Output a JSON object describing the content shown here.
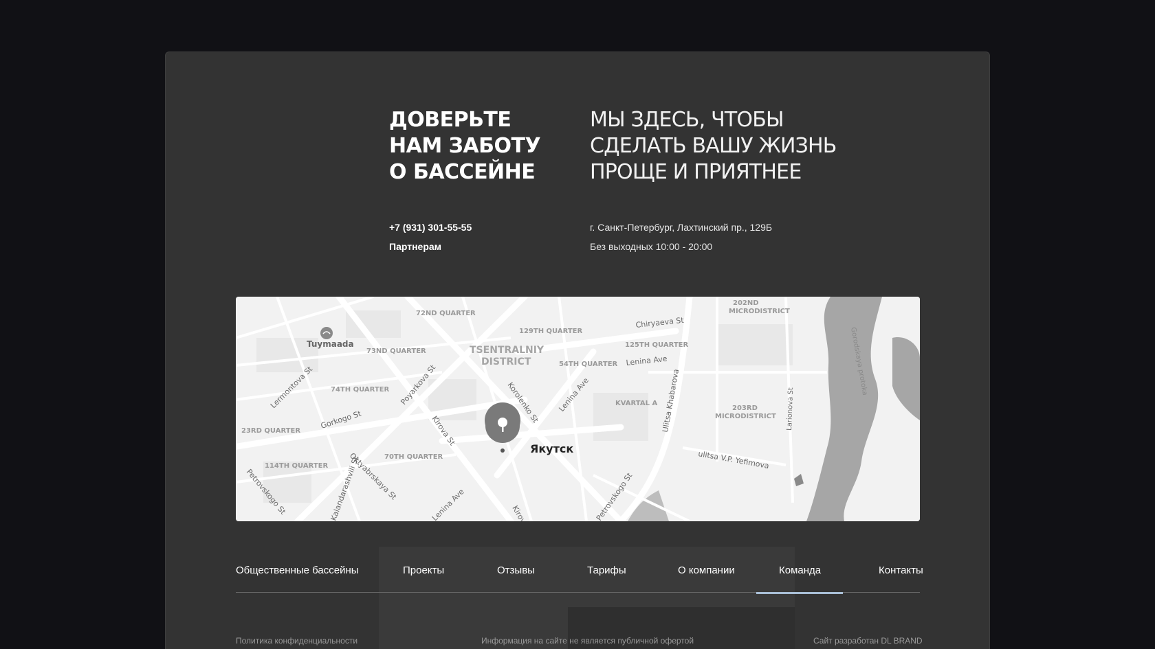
{
  "hero": {
    "left_lines": [
      "ДОВЕРЬТЕ",
      "НАМ ЗАБОТУ",
      "О БАССЕЙНЕ"
    ],
    "right_lines": [
      "МЫ ЗДЕСЬ, ЧТОБЫ",
      "СДЕЛАТЬ ВАШУ ЖИЗНЬ",
      "ПРОЩЕ И ПРИЯТНЕЕ"
    ]
  },
  "contacts": {
    "phone": "+7 (931) 301-55-55",
    "partners": "Партнерам",
    "address": "г. Санкт-Петербург, Лахтинский пр., 129Б",
    "hours": "Без выходных 10:00 - 20:00"
  },
  "map": {
    "marker_label": "Якутск",
    "district_labels": [
      "72ND QUARTER",
      "129TH QUARTER",
      "202ND",
      "MICRODISTRICT",
      "Tuymaada",
      "73ND QUARTER",
      "TSENTRALNIY",
      "DISTRICT",
      "54TH QUARTER",
      "125TH QUARTER",
      "74TH QUARTER",
      "KVARTAL A",
      "203RD",
      "MICRODISTRICT",
      "23RD QUARTER",
      "70TH QUARTER",
      "114TH QUARTER"
    ],
    "street_labels": [
      "Chiryaeva St",
      "Lenina Ave",
      "Gorodskaya protoka",
      "Lermontova St",
      "Poyarkova St",
      "Korolenko St",
      "Lenina Ave",
      "Ulitsa Khabarova",
      "Larionova St",
      "Gorkogo St",
      "Kirova St",
      "ulitsa V.P. Yefimova",
      "Oktyabrskaya St",
      "Petrovskogo St",
      "Kalandarashvili St",
      "Lenina Ave",
      "Kirova St",
      "Petrovskogo St"
    ]
  },
  "nav": {
    "items": [
      "Общественные бассейны",
      "Проекты",
      "Отзывы",
      "Тарифы",
      "О компании",
      "Команда",
      "Контакты"
    ],
    "active": "Команда"
  },
  "footer": {
    "privacy": "Политика конфиденциальности",
    "disclaimer": "Информация на сайте не является публичной офертой",
    "credit": "Сайт разработан DL BRAND"
  },
  "colors": {
    "page_bg": "#111115",
    "card_bg": "#333333",
    "active_underline": "#a9bfd6"
  }
}
